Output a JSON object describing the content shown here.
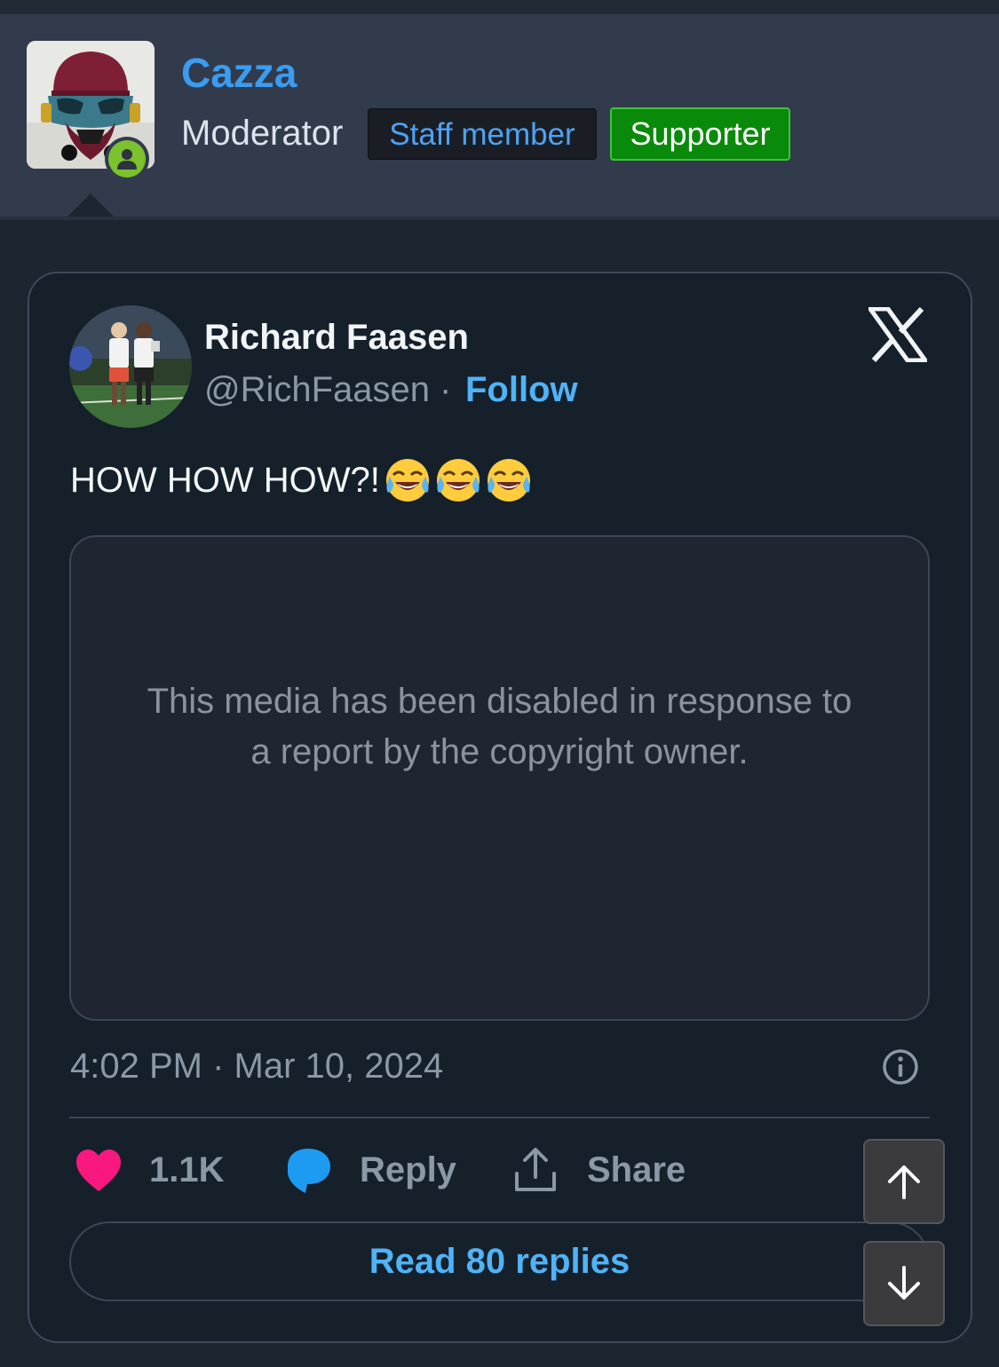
{
  "post_header": {
    "username": "Cazza",
    "role": "Moderator",
    "badges": [
      "Staff member",
      "Supporter"
    ]
  },
  "tweet": {
    "author_name": "Richard Faasen",
    "author_handle": "@RichFaasen",
    "separator": "·",
    "follow_label": "Follow",
    "text": "HOW HOW HOW?!",
    "emoji_count": 3,
    "emoji_name": "face-with-tears-of-joy",
    "media_message": "This media has been disabled in response to a report by the copyright owner.",
    "timestamp": "4:02 PM · Mar 10, 2024",
    "like_count": "1.1K",
    "reply_label": "Reply",
    "share_label": "Share",
    "read_replies_label": "Read 80 replies"
  },
  "colors": {
    "username": "#3b9cf0",
    "link": "#4fb3f7",
    "heart": "#f91880",
    "reply_bubble": "#1d9bf0",
    "supporter_badge": "#0a8a0a",
    "online_status": "#7cc12e"
  },
  "icons": [
    "x-logo-icon",
    "info-icon",
    "heart-icon",
    "reply-bubble-icon",
    "share-icon",
    "arrow-up-icon",
    "arrow-down-icon",
    "online-status-icon"
  ]
}
